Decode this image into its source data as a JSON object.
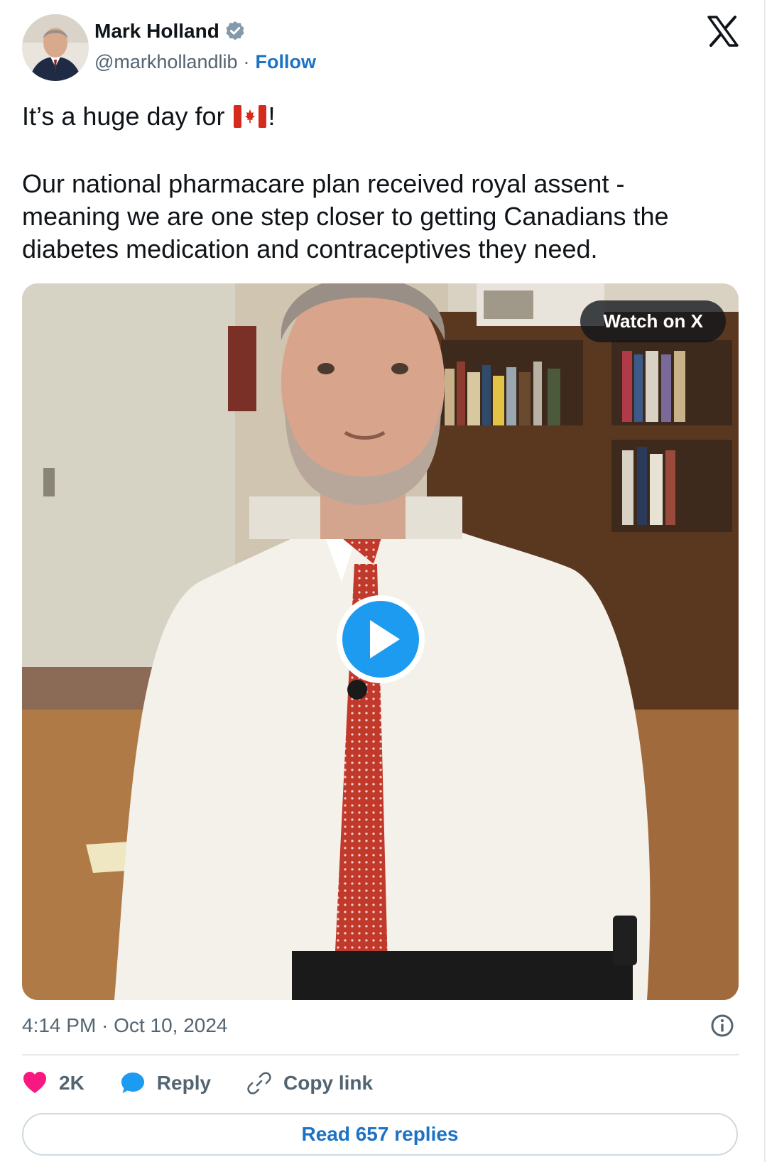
{
  "author": {
    "name": "Mark Holland",
    "handle": "@markhollandlib",
    "separator": "·",
    "follow_label": "Follow"
  },
  "tweet": {
    "line1_prefix": "It’s a huge day for",
    "line1_suffix": "!",
    "body_lines": [
      "Our national pharmacare plan received royal assent -",
      "meaning we are one step closer to getting Canadians the",
      "diabetes medication and contraceptives they need."
    ]
  },
  "media": {
    "watch_label": "Watch on X"
  },
  "timestamp": "4:14 PM · Oct 10, 2024",
  "actions": {
    "like_count": "2K",
    "reply_label": "Reply",
    "copy_label": "Copy link"
  },
  "read_replies_label": "Read 657 replies",
  "icons": {
    "brand": "x-logo-icon",
    "verified": "verified-badge-icon",
    "flag": "canada-flag-icon",
    "play": "play-icon",
    "info": "info-icon",
    "like": "heart-icon",
    "reply": "chat-bubble-icon",
    "copy": "link-icon"
  },
  "colors": {
    "link_blue": "#1d72c4",
    "like_pink": "#f91880",
    "reply_blue": "#1d9bf0",
    "muted_gray": "#536471"
  }
}
